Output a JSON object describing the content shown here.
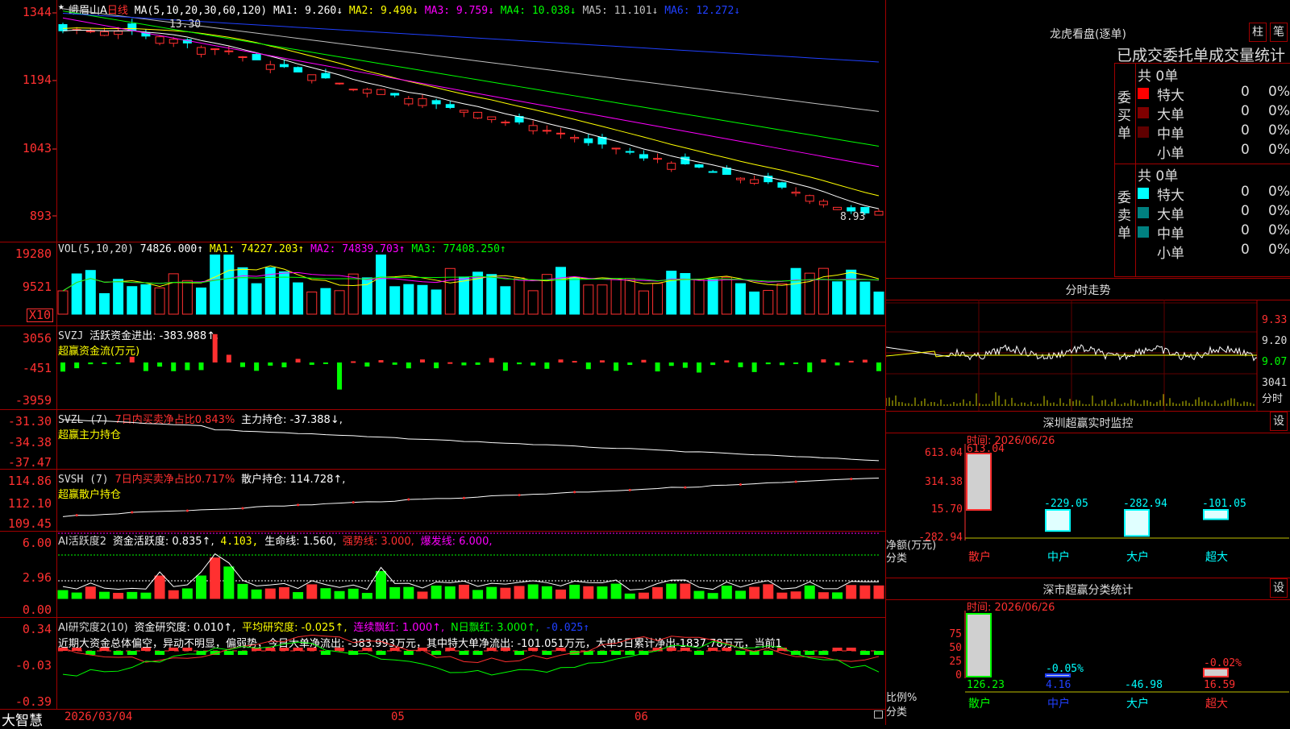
{
  "stock": {
    "name": "峨眉山A",
    "period": "日线"
  },
  "price_panel": {
    "ma_label": "MA(5,10,20,30,60,120)",
    "ma1": "MA1: 9.260↓",
    "ma2": "MA2: 9.490↓",
    "ma3": "MA3: 9.759↓",
    "ma4": "MA4: 10.038↓",
    "ma5": "MA5: 11.101↓",
    "ma6": "MA6: 12.272↓",
    "ticks": [
      "1344",
      "1194",
      "1043",
      "893"
    ],
    "high_label": "13.30",
    "low_label": "8.93",
    "colors": {
      "ma1": "#ffffff",
      "ma2": "#ffff00",
      "ma3": "#ff00ff",
      "ma4": "#00ff00",
      "ma5": "#c0c0c0",
      "ma6": "#2040ff"
    }
  },
  "vol_panel": {
    "label": "VOL(5,10,20)",
    "value": "74826.000↑",
    "ma1": "MA1: 74227.203↑",
    "ma2": "MA2: 74839.703↑",
    "ma3": "MA3: 77408.250↑",
    "ticks": [
      "19280",
      "9521"
    ],
    "unit": "X10"
  },
  "svzj_panel": {
    "label": "SVZJ",
    "line1": "活跃资金进出: -383.988↑,",
    "line2": "超赢资金流(万元)",
    "ticks": [
      "3056",
      "-451",
      "-3959"
    ]
  },
  "svzl_panel": {
    "label": "SVZL (7)",
    "pct": "7日内买卖净占比0.843%",
    "hold": "主力持仓: -37.388↓,",
    "line2": "超赢主力持仓",
    "ticks": [
      "-31.30",
      "-34.38",
      "-37.47"
    ]
  },
  "svsh_panel": {
    "label": "SVSH (7)",
    "pct": "7日内买卖净占比0.717%",
    "hold": "散户持仓: 114.728↑,",
    "line2": "超赢散户持仓",
    "ticks": [
      "114.86",
      "112.10",
      "109.45"
    ]
  },
  "ai_panel": {
    "label": "AI活跃度2",
    "v1": "资金活跃度: 0.835↑,",
    "v2": "4.103,",
    "v3": "生命线: 1.560,",
    "v4": "强势线: 3.000,",
    "v5": "爆发线: 6.000,",
    "ticks": [
      "6.00",
      "2.96",
      "0.00"
    ]
  },
  "research_panel": {
    "label": "AI研究度2(10)",
    "v1": "资金研究度: 0.010↑,",
    "v2": "平均研究度: -0.025↑,",
    "v3": "连续飘红: 1.000↑,",
    "v4": "N日飘红: 3.000↑,",
    "v5": "-0.025↑",
    "text": "近期大资金总体偏空，异动不明显，偏弱势，今日大单净流出: -383.993万元，其中特大单净流出: -101.051万元，大单5日累计净出-1837.78万元，当前1",
    "ticks": [
      "0.34",
      "-0.03",
      "-0.39"
    ]
  },
  "dates": {
    "d1": "2026/03/04",
    "d2": "05",
    "d3": "06"
  },
  "brand": "大智慧",
  "right": {
    "lhkp_title": "龙虎看盘(逐单)",
    "btn1": "柱",
    "btn2": "笔",
    "stats_title": "已成交委托单成交量统计",
    "buy": {
      "label": "委买单",
      "total": "共 0单",
      "rows": [
        {
          "name": "特大",
          "v": "0",
          "p": "0%",
          "c": "#ff0000"
        },
        {
          "name": "大单",
          "v": "0",
          "p": "0%",
          "c": "#800000"
        },
        {
          "name": "中单",
          "v": "0",
          "p": "0%",
          "c": "#600000"
        },
        {
          "name": "小单",
          "v": "0",
          "p": "0%",
          "c": "#000000"
        }
      ]
    },
    "sell": {
      "label": "委卖单",
      "total": "共 0单",
      "rows": [
        {
          "name": "特大",
          "v": "0",
          "p": "0%",
          "c": "#00ffff"
        },
        {
          "name": "大单",
          "v": "0",
          "p": "0%",
          "c": "#008080"
        },
        {
          "name": "中单",
          "v": "0",
          "p": "0%",
          "c": "#008080"
        },
        {
          "name": "小单",
          "v": "0",
          "p": "0%",
          "c": "#000000"
        }
      ]
    },
    "fs_title": "分时走势",
    "fs_ticks": [
      "9.33",
      "9.20",
      "9.07"
    ],
    "fs_vol": "3041",
    "fs_vol_label": "分时",
    "mon_title": "深圳超赢实时监控",
    "mon_btn": "设",
    "mon_time": "时间: 2026/06/26",
    "mon_ticks": [
      "613.04",
      "314.38",
      "15.70",
      "-282.94"
    ],
    "mon_bars": [
      {
        "cat": "散户",
        "v": "613.04"
      },
      {
        "cat": "中户",
        "v": "-229.05"
      },
      {
        "cat": "大户",
        "v": "-282.94"
      },
      {
        "cat": "超大",
        "v": "-101.05"
      }
    ],
    "mon_ylabel": "净额(万元)",
    "mon_xlabel": "分类",
    "cls_title": "深市超赢分类统计",
    "cls_btn": "设",
    "cls_time": "时间: 2026/06/26",
    "cls_ticks": [
      "75",
      "50",
      "25",
      "0"
    ],
    "cls_bars": [
      {
        "cat": "散户",
        "v": "126.23",
        "top": ""
      },
      {
        "cat": "中户",
        "v": "4.16",
        "top": "-0.05%"
      },
      {
        "cat": "大户",
        "v": "-46.98",
        "top": ""
      },
      {
        "cat": "超大",
        "v": "16.59",
        "top": "-0.02%"
      }
    ],
    "cls_ylabel": "比例%",
    "cls_xlabel": "分类"
  }
}
